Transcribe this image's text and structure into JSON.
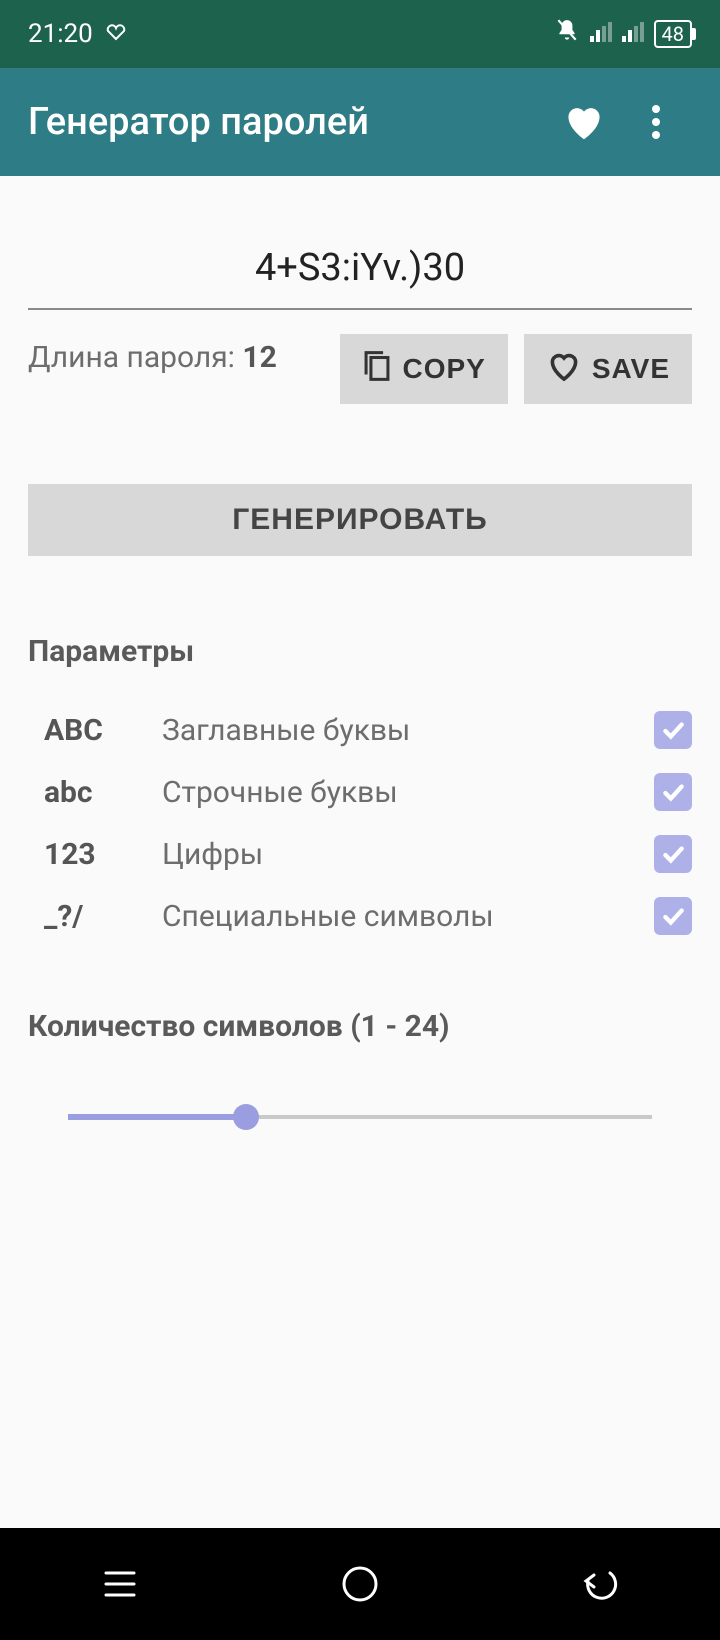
{
  "status": {
    "time": "21:20",
    "battery": "48"
  },
  "appbar": {
    "title": "Генератор паролей"
  },
  "password": {
    "value": "4+S3:iYv.)30",
    "length_label": "Длина пароля: ",
    "length_value": "12"
  },
  "buttons": {
    "copy": "COPY",
    "save": "SAVE",
    "generate": "ГЕНЕРИРОВАТЬ"
  },
  "sections": {
    "params": "Параметры",
    "count": "Количество символов (1 - 24)"
  },
  "options": [
    {
      "code": "ABC",
      "label": "Заглавные буквы",
      "checked": true
    },
    {
      "code": "abc",
      "label": "Строчные буквы",
      "checked": true
    },
    {
      "code": "123",
      "label": "Цифры",
      "checked": true
    },
    {
      "code": "_?/",
      "label": "Специальные символы",
      "checked": true
    }
  ],
  "slider": {
    "min": 1,
    "max": 24,
    "value": 8
  }
}
